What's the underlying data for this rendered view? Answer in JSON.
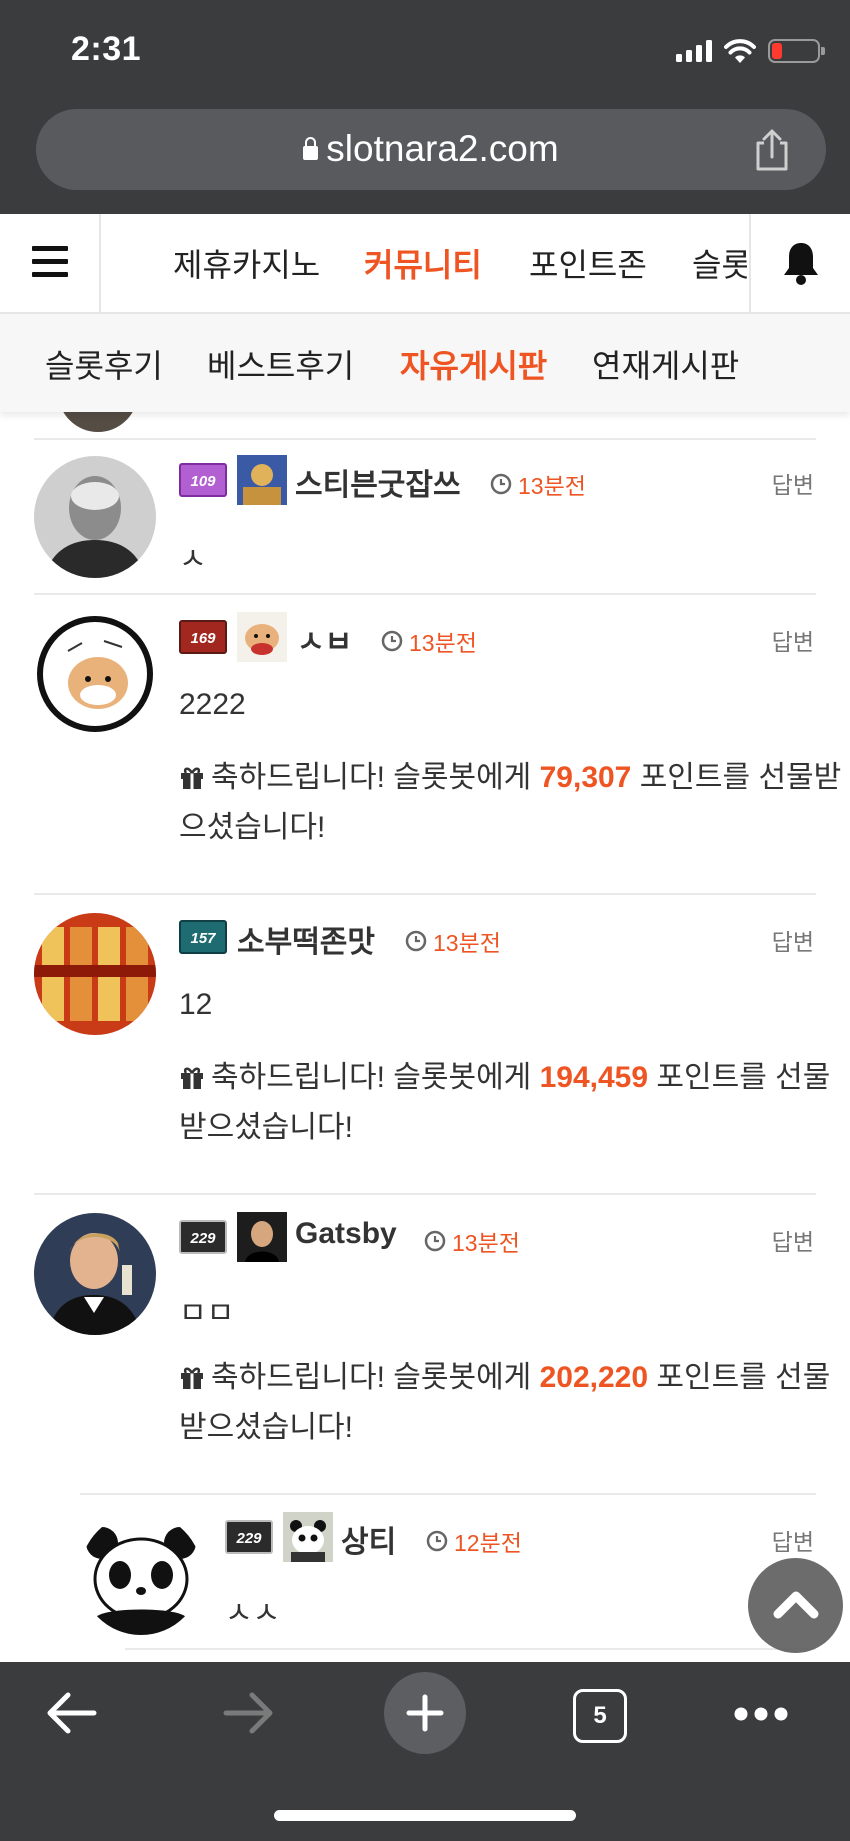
{
  "status_bar": {
    "time": "2:31"
  },
  "browser": {
    "url": "slotnara2.com",
    "tab_count": "5"
  },
  "main_nav": {
    "items": [
      {
        "label": "제휴카지노",
        "active": false
      },
      {
        "label": "커뮤니티",
        "active": true
      },
      {
        "label": "포인트존",
        "active": false
      },
      {
        "label": "슬롯",
        "active": false
      }
    ]
  },
  "sub_nav": {
    "items": [
      {
        "label": "슬롯후기",
        "active": false
      },
      {
        "label": "베스트후기",
        "active": false
      },
      {
        "label": "자유게시판",
        "active": true
      },
      {
        "label": "연재게시판",
        "active": false
      }
    ]
  },
  "comments": [
    {
      "level": "109",
      "nickname": "스티븐굿잡쓰",
      "time": "13분전",
      "reply": "답변",
      "body": "ㅅ"
    },
    {
      "level": "169",
      "nickname": "ㅅㅂ",
      "time": "13분전",
      "reply": "답변",
      "body": "2222",
      "gift": {
        "prefix": "축하드립니다! 슬롯봇에게 ",
        "points": "79,307",
        "suffix": " 포인트를 선물받으셨습니다!"
      }
    },
    {
      "level": "157",
      "nickname": "소부떡존맛",
      "time": "13분전",
      "reply": "답변",
      "body": "12",
      "gift": {
        "prefix": "축하드립니다! 슬롯봇에게 ",
        "points": "194,459",
        "suffix": " 포인트를 선물받으셨습니다!"
      }
    },
    {
      "level": "229",
      "nickname": "Gatsby",
      "time": "13분전",
      "reply": "답변",
      "body": "ㅁㅁ",
      "gift": {
        "prefix": "축하드립니다! 슬롯봇에게 ",
        "points": "202,220",
        "suffix": " 포인트를 선물받으셨습니다!"
      }
    },
    {
      "level": "229",
      "nickname": "상티",
      "time": "12분전",
      "reply": "답변",
      "body": "ㅅㅅ"
    }
  ],
  "colors": {
    "accent": "#ee5523",
    "chrome": "#3b3c3e",
    "url_bar": "#595a5d"
  }
}
